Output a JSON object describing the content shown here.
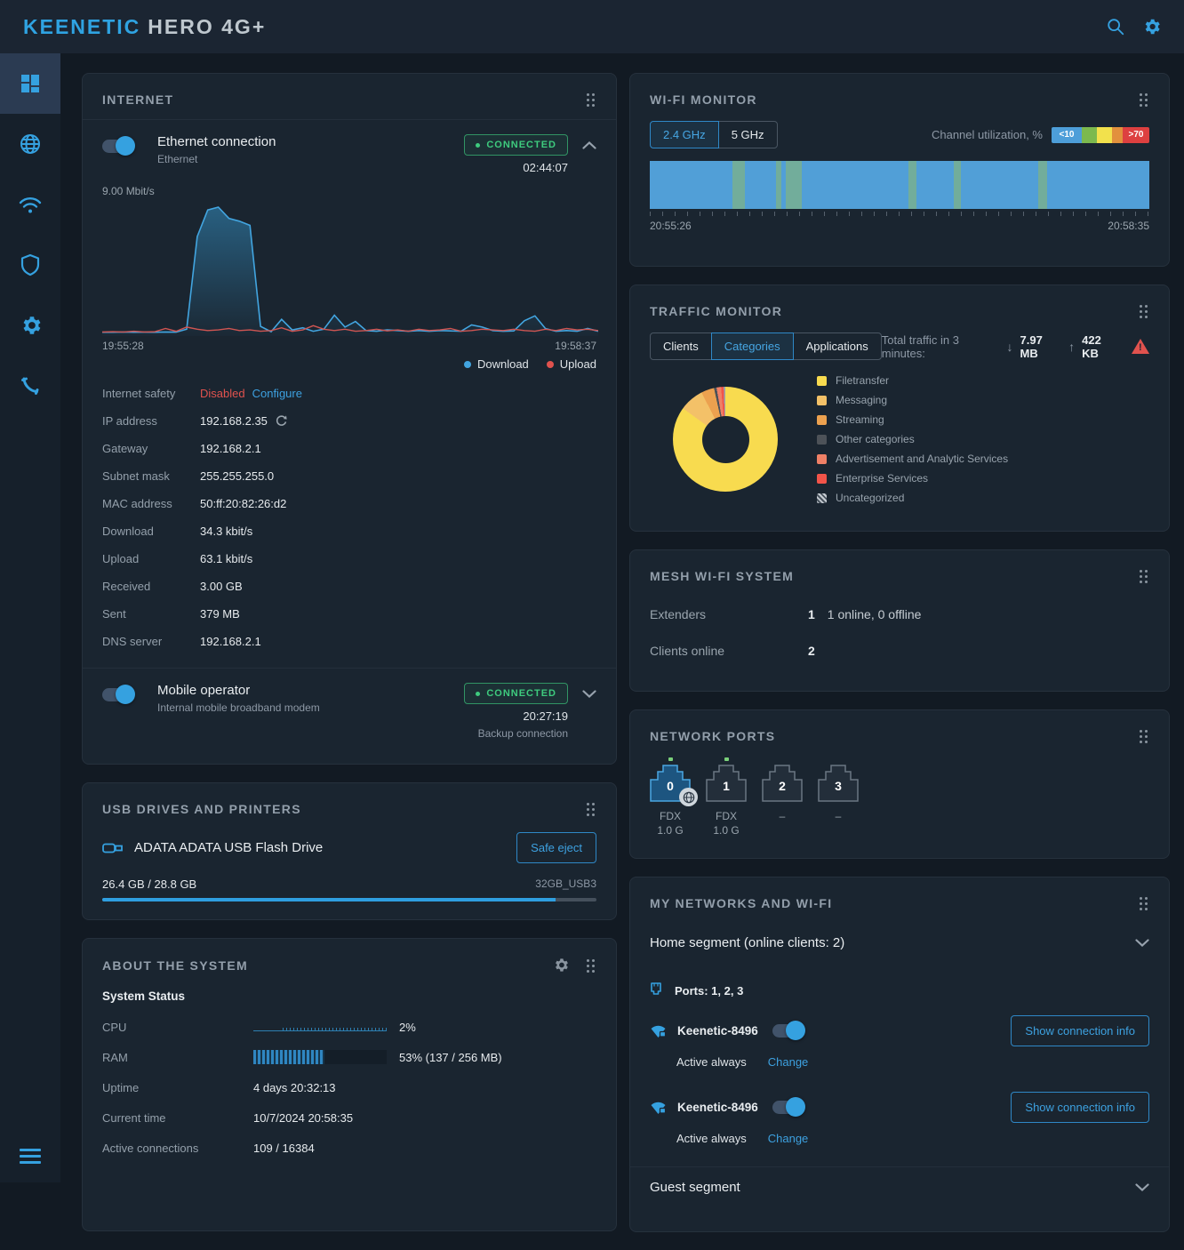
{
  "header": {
    "brand_primary": "KEENETIC",
    "brand_secondary": "HERO 4G+"
  },
  "sidebar": {
    "items": [
      "dashboard",
      "internet",
      "wifi",
      "security",
      "settings",
      "support"
    ],
    "active": "dashboard"
  },
  "internet": {
    "title": "INTERNET",
    "ethernet": {
      "name": "Ethernet connection",
      "subtitle": "Ethernet",
      "status": "CONNECTED",
      "uptime": "02:44:07"
    },
    "chart": {
      "max_label": "9.00 Mbit/s",
      "x_start": "19:55:28",
      "x_end": "19:58:37",
      "ymax": 9,
      "legend": [
        {
          "label": "Download",
          "color": "#42a5e0"
        },
        {
          "label": "Upload",
          "color": "#e0524e"
        }
      ],
      "download": [
        0.08,
        0.08,
        0.1,
        0.08,
        0.09,
        0.08,
        0.1,
        0.09,
        0.3,
        6.9,
        8.8,
        9.0,
        8.2,
        8.0,
        7.7,
        0.5,
        0.12,
        1.0,
        0.25,
        0.4,
        0.15,
        0.3,
        1.3,
        0.45,
        0.85,
        0.2,
        0.15,
        0.25,
        0.2,
        0.15,
        0.2,
        0.15,
        0.2,
        0.18,
        0.15,
        0.6,
        0.45,
        0.2,
        0.15,
        0.18,
        0.9,
        1.25,
        0.35,
        0.15,
        0.2,
        0.15,
        0.35,
        0.15
      ],
      "upload": [
        0.1,
        0.12,
        0.1,
        0.15,
        0.1,
        0.12,
        0.35,
        0.15,
        0.45,
        0.3,
        0.2,
        0.25,
        0.35,
        0.2,
        0.25,
        0.15,
        0.2,
        0.4,
        0.15,
        0.25,
        0.55,
        0.3,
        0.2,
        0.3,
        0.15,
        0.2,
        0.3,
        0.18,
        0.25,
        0.15,
        0.3,
        0.2,
        0.25,
        0.35,
        0.15,
        0.2,
        0.3,
        0.25,
        0.2,
        0.3,
        0.2,
        0.15,
        0.3,
        0.2,
        0.35,
        0.25,
        0.3,
        0.2
      ]
    },
    "details": [
      {
        "label": "Internet safety",
        "value": "Disabled",
        "value2": "Configure"
      },
      {
        "label": "IP address",
        "value": "192.168.2.35"
      },
      {
        "label": "Gateway",
        "value": "192.168.2.1"
      },
      {
        "label": "Subnet mask",
        "value": "255.255.255.0"
      },
      {
        "label": "MAC address",
        "value": "50:ff:20:82:26:d2"
      },
      {
        "label": "Download",
        "value": "34.3 kbit/s"
      },
      {
        "label": "Upload",
        "value": "63.1 kbit/s"
      },
      {
        "label": "Received",
        "value": "3.00 GB"
      },
      {
        "label": "Sent",
        "value": "379 MB"
      },
      {
        "label": "DNS server",
        "value": "192.168.2.1"
      }
    ],
    "mobile": {
      "name": "Mobile operator",
      "subtitle": "Internal mobile broadband modem",
      "status": "CONNECTED",
      "uptime": "20:27:19",
      "note": "Backup connection"
    }
  },
  "usb": {
    "title": "USB DRIVES AND PRINTERS",
    "device": "ADATA ADATA USB Flash Drive",
    "eject_label": "Safe eject",
    "usage": "26.4 GB / 28.8 GB",
    "volume": "32GB_USB3",
    "percent": 91.7
  },
  "about": {
    "title": "ABOUT THE SYSTEM",
    "section": "System Status",
    "cpu_label": "CPU",
    "cpu_value": "2%",
    "cpu_percent": 2,
    "ram_label": "RAM",
    "ram_value": "53% (137 / 256 MB)",
    "ram_percent": 53,
    "rows": [
      {
        "label": "Uptime",
        "value": "4 days 20:32:13"
      },
      {
        "label": "Current time",
        "value": "10/7/2024 20:58:35"
      },
      {
        "label": "Active connections",
        "value": "109 / 16384"
      }
    ]
  },
  "wifi_monitor": {
    "title": "WI-FI MONITOR",
    "tabs": [
      "2.4 GHz",
      "5 GHz"
    ],
    "active_tab": 0,
    "legend_label": "Channel utilization, %",
    "legend_min": "<10",
    "legend_max": ">70",
    "scale_colors": [
      "#4d9ed9",
      "#7cb94e",
      "#f2e14c",
      "#e2913d",
      "#dd4040"
    ],
    "x_start": "20:55:26",
    "x_end": "20:58:35",
    "bar_color": "#519fd7",
    "stripe_color": "#72ad9b",
    "stripes": [
      {
        "x": 0.165,
        "w": 0.025
      },
      {
        "x": 0.252,
        "w": 0.012
      },
      {
        "x": 0.272,
        "w": 0.033
      },
      {
        "x": 0.518,
        "w": 0.015
      },
      {
        "x": 0.608,
        "w": 0.015
      },
      {
        "x": 0.778,
        "w": 0.018
      }
    ]
  },
  "traffic_monitor": {
    "title": "TRAFFIC MONITOR",
    "tabs": [
      "Clients",
      "Categories",
      "Applications"
    ],
    "active_tab": 1,
    "total_label": "Total traffic in 3 minutes:",
    "down_arrow": "↓",
    "down_value": "7.97 MB",
    "up_arrow": "↑",
    "up_value": "422 KB",
    "chart_data": {
      "type": "pie",
      "categories": [
        {
          "label": "Filetransfer",
          "color": "#f8db4f",
          "value": 85
        },
        {
          "label": "Messaging",
          "color": "#f3c168",
          "value": 7.5
        },
        {
          "label": "Streaming",
          "color": "#eca14f",
          "value": 4
        },
        {
          "label": "Other categories",
          "color": "#4d5258",
          "value": 0.8
        },
        {
          "label": "Advertisement and Analytic Services",
          "color": "#ef8066",
          "value": 1.4
        },
        {
          "label": "Enterprise Services",
          "color": "#f25449",
          "value": 0.8
        },
        {
          "label": "Uncategorized",
          "color": "hatch",
          "value": 0.5
        }
      ]
    }
  },
  "mesh": {
    "title": "MESH WI-FI SYSTEM",
    "rows": [
      {
        "label": "Extenders",
        "value": "1",
        "extra": "1 online, 0 offline"
      },
      {
        "label": "Clients online",
        "value": "2",
        "extra": ""
      }
    ]
  },
  "ports": {
    "title": "NETWORK PORTS",
    "items": [
      {
        "number": "0",
        "line1": "FDX",
        "line2": "1.0 G",
        "active": true,
        "link": true,
        "wan": true
      },
      {
        "number": "1",
        "line1": "FDX",
        "line2": "1.0 G",
        "active": false,
        "link": true,
        "wan": false
      },
      {
        "number": "2",
        "line1": "–",
        "line2": "",
        "active": false,
        "link": false,
        "wan": false
      },
      {
        "number": "3",
        "line1": "–",
        "line2": "",
        "active": false,
        "link": false,
        "wan": false
      }
    ]
  },
  "networks": {
    "title": "MY NETWORKS AND WI-FI",
    "home_segment": "Home segment (online clients: 2)",
    "ports_label": "Ports: 1, 2, 3",
    "wifi": [
      {
        "ssid": "Keenetic-8496",
        "schedule": "Active always",
        "change_label": "Change",
        "button": "Show connection info"
      },
      {
        "ssid": "Keenetic-8496",
        "schedule": "Active always",
        "change_label": "Change",
        "button": "Show connection info"
      }
    ],
    "guest_segment": "Guest segment"
  }
}
